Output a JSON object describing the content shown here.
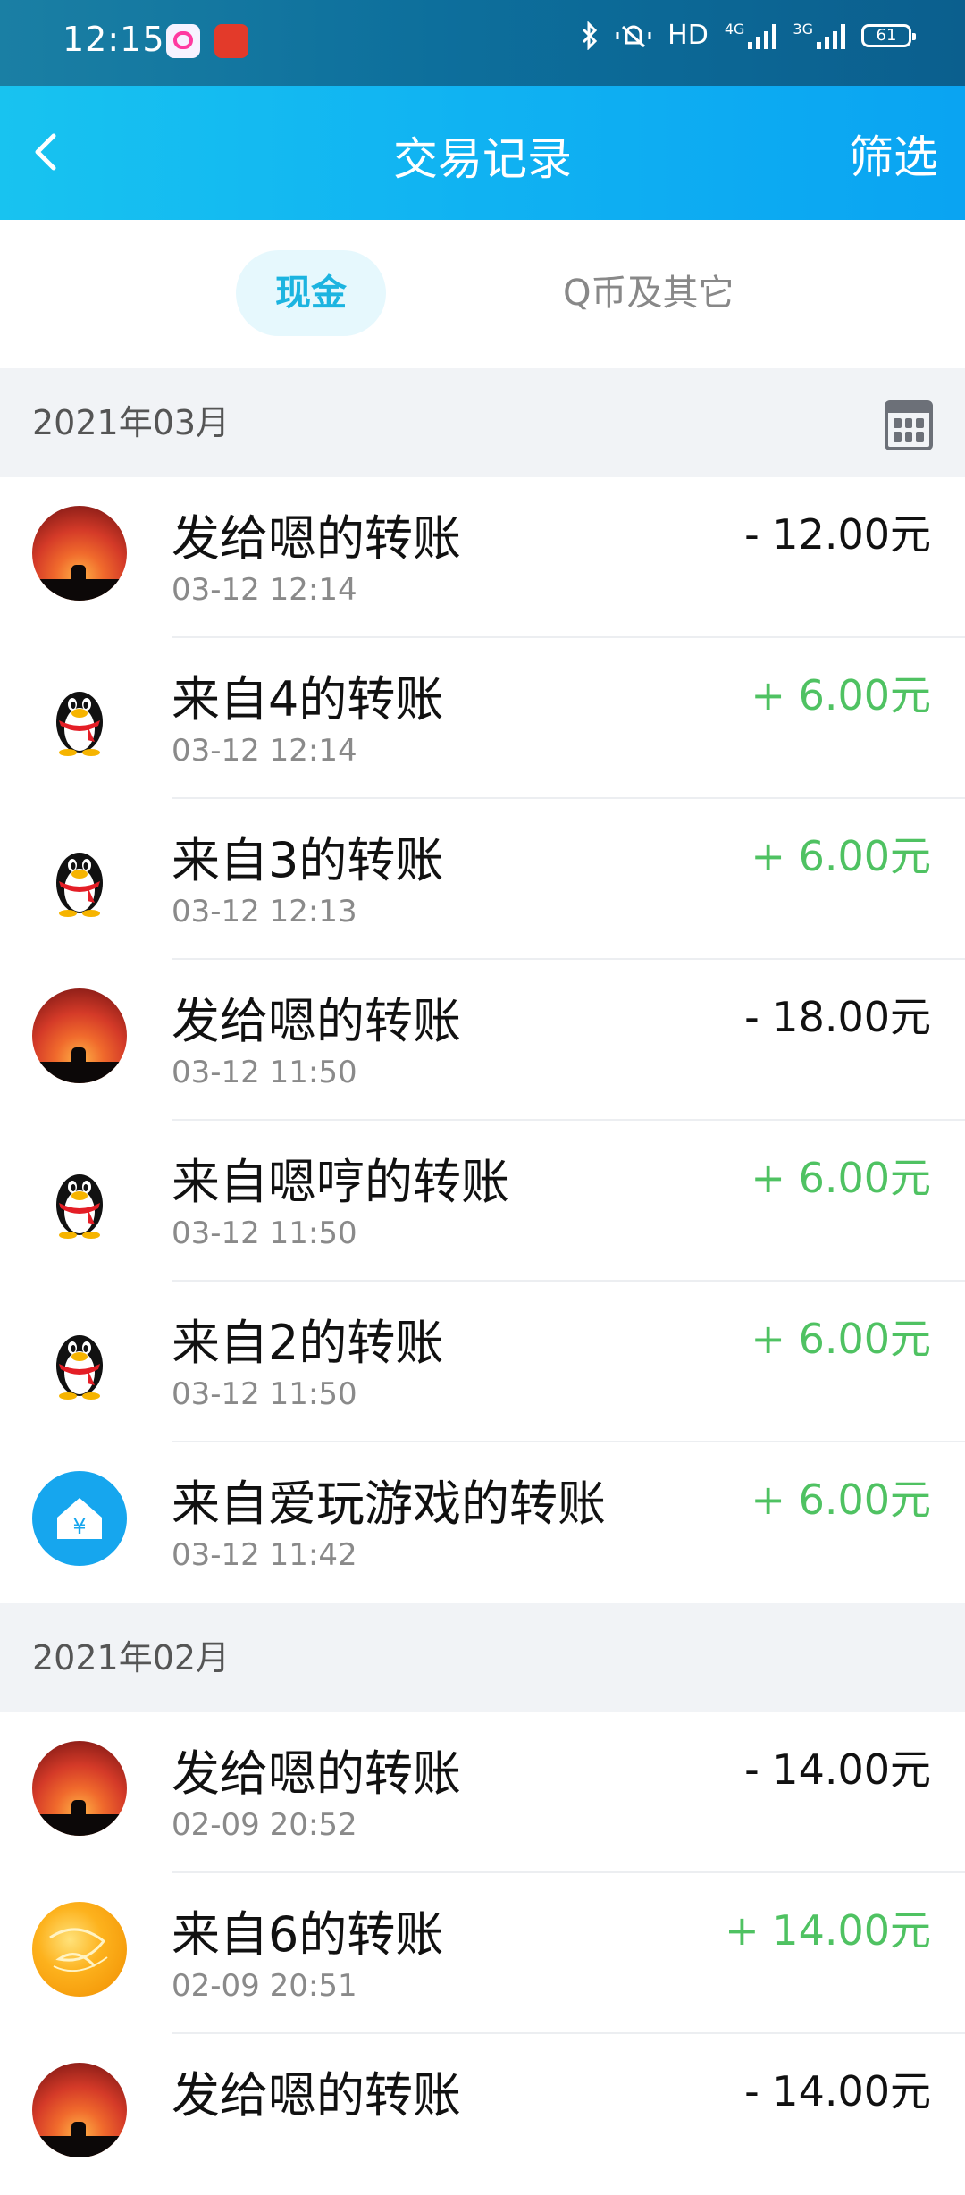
{
  "status_bar": {
    "time": "12:15",
    "network": "HD",
    "net4g": "4G",
    "net3g": "3G",
    "battery": "61"
  },
  "header": {
    "title": "交易记录",
    "filter_label": "筛选"
  },
  "tabs": [
    {
      "label": "现金",
      "active": true
    },
    {
      "label": "Q币及其它",
      "active": false
    }
  ],
  "sections": [
    {
      "label": "2021年03月",
      "items": [
        {
          "avatar": "sunset-cat-avatar",
          "title": "发给嗯的转账",
          "time": "03-12 12:14",
          "amount": "- 12.00元",
          "sign": "neg"
        },
        {
          "avatar": "qq-penguin-avatar",
          "title": "来自4的转账",
          "time": "03-12 12:14",
          "amount": "+ 6.00元",
          "sign": "pos"
        },
        {
          "avatar": "qq-penguin-avatar",
          "title": "来自3的转账",
          "time": "03-12 12:13",
          "amount": "+ 6.00元",
          "sign": "pos"
        },
        {
          "avatar": "sunset-cat-avatar",
          "title": "发给嗯的转账",
          "time": "03-12 11:50",
          "amount": "- 18.00元",
          "sign": "neg"
        },
        {
          "avatar": "qq-penguin-avatar",
          "title": "来自嗯哼的转账",
          "time": "03-12 11:50",
          "amount": "+ 6.00元",
          "sign": "pos"
        },
        {
          "avatar": "qq-penguin-avatar",
          "title": "来自2的转账",
          "time": "03-12 11:50",
          "amount": "+ 6.00元",
          "sign": "pos"
        },
        {
          "avatar": "yuan-house-avatar",
          "title": "来自爱玩游戏的转账",
          "time": "03-12 11:42",
          "amount": "+ 6.00元",
          "sign": "pos"
        }
      ]
    },
    {
      "label": "2021年02月",
      "items": [
        {
          "avatar": "sunset-cat-avatar",
          "title": "发给嗯的转账",
          "time": "02-09 20:52",
          "amount": "- 14.00元",
          "sign": "neg"
        },
        {
          "avatar": "orange-avatar",
          "title": "来自6的转账",
          "time": "02-09 20:51",
          "amount": "+ 14.00元",
          "sign": "pos"
        },
        {
          "avatar": "sunset-cat-avatar",
          "title": "发给嗯的转账",
          "time": "",
          "amount": "- 14.00元",
          "sign": "neg"
        }
      ]
    }
  ]
}
